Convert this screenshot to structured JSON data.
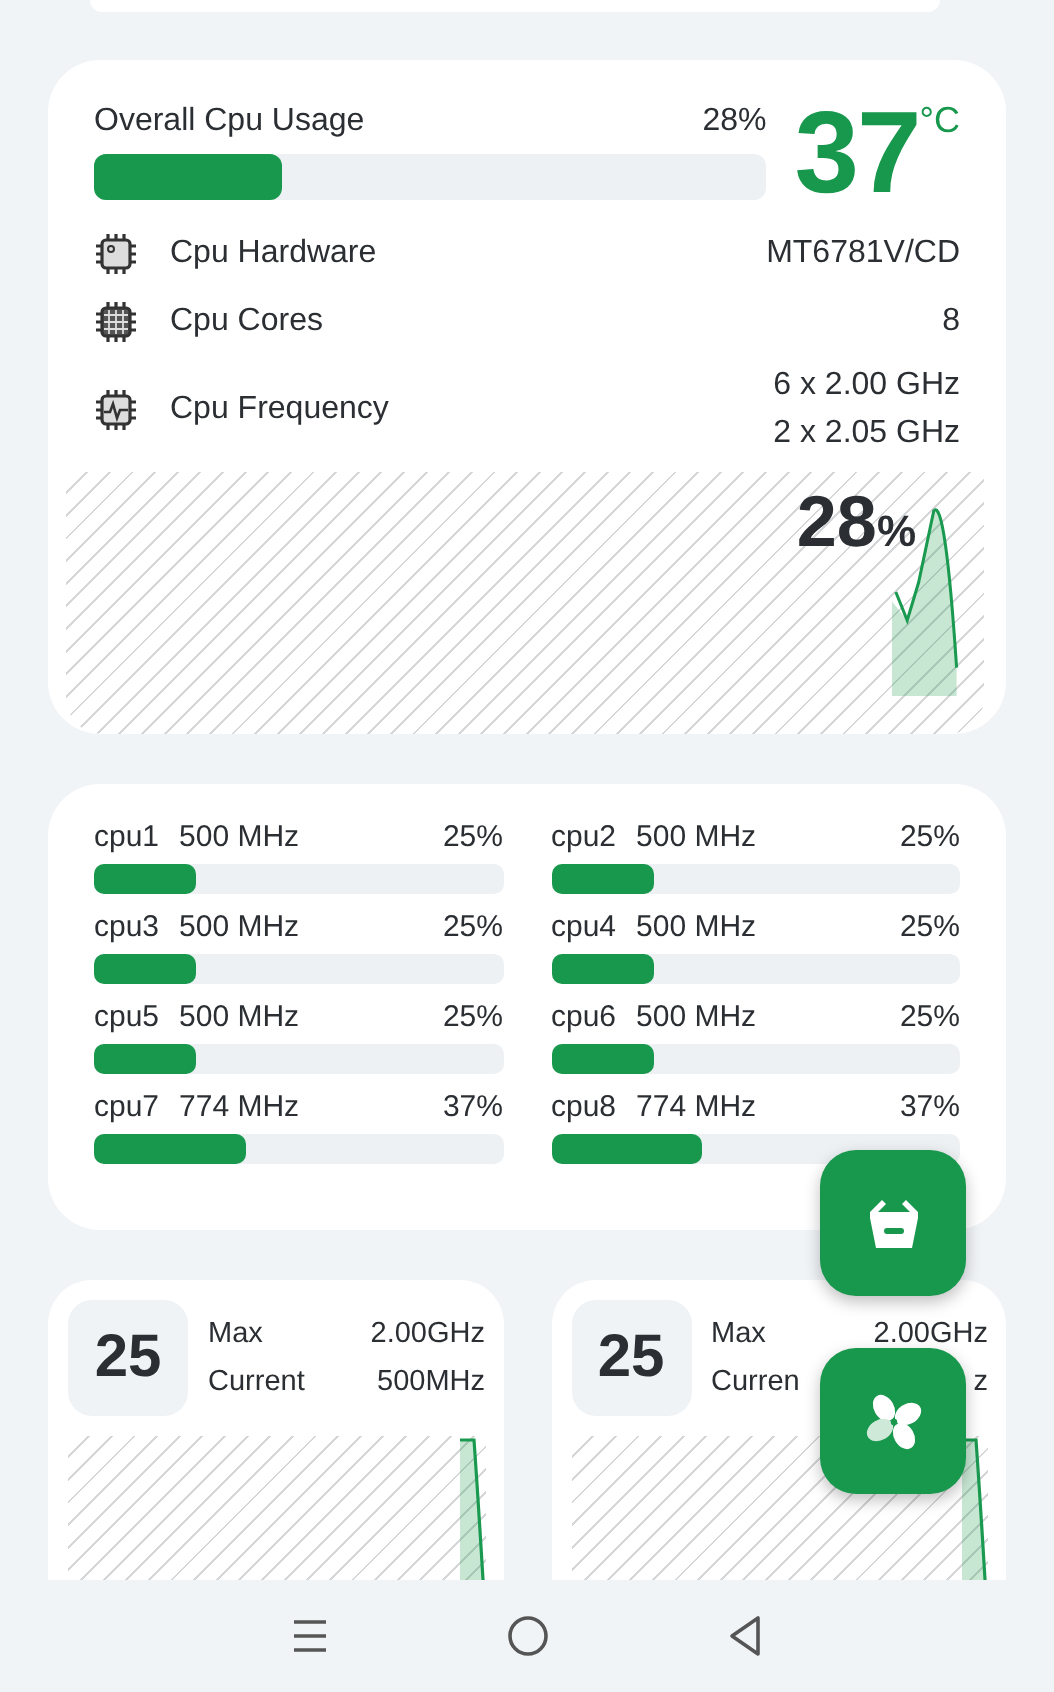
{
  "overview": {
    "title": "Overall Cpu Usage",
    "usage": "28%",
    "level": 0.28,
    "temperature": "37",
    "temperature_unit": "°C",
    "specs": [
      {
        "kind": "hardware",
        "label": "Cpu Hardware",
        "values": [
          "MT6781V/CD"
        ]
      },
      {
        "kind": "cores",
        "label": "Cpu Cores",
        "values": [
          "8"
        ]
      },
      {
        "kind": "frequency",
        "label": "Cpu Frequency",
        "values": [
          "6 x 2.00 GHz",
          "2 x 2.05 GHz"
        ]
      }
    ],
    "chart_reading": "28",
    "chart_reading_unit": "%"
  },
  "cores": [
    {
      "name": "cpu1",
      "frequency": "500 MHz",
      "usage": "25%",
      "level": 0.25
    },
    {
      "name": "cpu2",
      "frequency": "500 MHz",
      "usage": "25%",
      "level": 0.25
    },
    {
      "name": "cpu3",
      "frequency": "500 MHz",
      "usage": "25%",
      "level": 0.25
    },
    {
      "name": "cpu4",
      "frequency": "500 MHz",
      "usage": "25%",
      "level": 0.25
    },
    {
      "name": "cpu5",
      "frequency": "500 MHz",
      "usage": "25%",
      "level": 0.25
    },
    {
      "name": "cpu6",
      "frequency": "500 MHz",
      "usage": "25%",
      "level": 0.25
    },
    {
      "name": "cpu7",
      "frequency": "774 MHz",
      "usage": "37%",
      "level": 0.37
    },
    {
      "name": "cpu8",
      "frequency": "774 MHz",
      "usage": "37%",
      "level": 0.37
    }
  ],
  "core_cards": [
    {
      "number": "25",
      "max_label": "Max",
      "max_value": "2.00GHz",
      "current_label": "Current",
      "current_value": "500MHz"
    },
    {
      "number": "25",
      "max_label": "Max",
      "max_value": "2.00GHz",
      "current_label": "Curren",
      "current_value": "z"
    }
  ],
  "fabs": [
    {
      "kind": "basket"
    },
    {
      "kind": "fan"
    }
  ],
  "nav": [
    {
      "kind": "menu"
    },
    {
      "kind": "home"
    },
    {
      "kind": "back"
    }
  ]
}
